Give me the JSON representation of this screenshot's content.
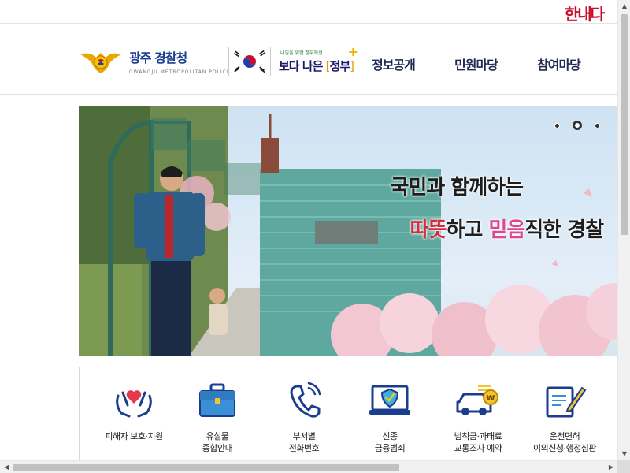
{
  "top": {
    "hangul_logo": "한내다"
  },
  "header": {
    "police_name": "광주 경찰청",
    "police_sub": "GWANGJU METROPOLITAN POLICE",
    "gov_small": "내일을 위한 정부혁신",
    "gov_main_a": "보다 나은",
    "gov_main_b": "정부",
    "nav": [
      "정보공개",
      "민원마당",
      "참여마당"
    ]
  },
  "banner": {
    "line1": "국민과 함께하는",
    "line2_a": "따뜻",
    "line2_b": "하고 ",
    "line2_c": "믿음",
    "line2_d": "직한 경찰",
    "slides": 3,
    "active_slide": 2
  },
  "quick_menu": [
    {
      "icon": "hands-heart-icon",
      "label1": "피해자 보호·지원",
      "label2": ""
    },
    {
      "icon": "briefcase-icon",
      "label1": "유실물",
      "label2": "종합안내"
    },
    {
      "icon": "phone-icon",
      "label1": "부서별",
      "label2": "전화번호"
    },
    {
      "icon": "shield-laptop-icon",
      "label1": "신종",
      "label2": "금융범죄"
    },
    {
      "icon": "car-coin-icon",
      "label1": "범칙금·과태료",
      "label2": "교통조사 예약"
    },
    {
      "icon": "document-pen-icon",
      "label1": "운전면허",
      "label2": "이의신청·행정심판"
    }
  ],
  "colors": {
    "navy": "#1f2a55",
    "accent_red": "#d72b3b",
    "accent_pink": "#e0458f"
  }
}
